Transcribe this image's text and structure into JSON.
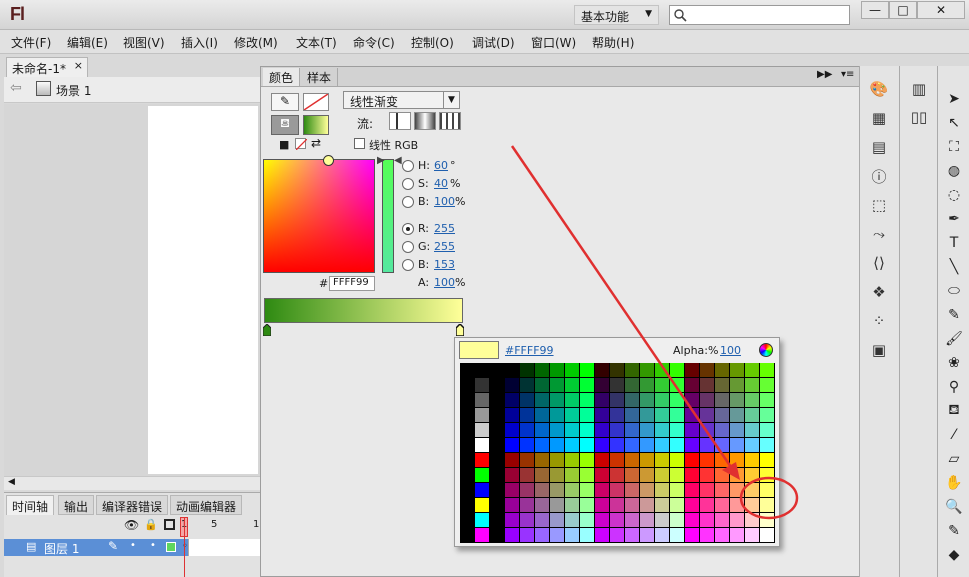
{
  "app": {
    "logo": "Fl"
  },
  "titlebar": {
    "workspace": "基本功能",
    "search_value": ""
  },
  "window_controls": {
    "minimize": "—",
    "maximize": "□",
    "close": "✕"
  },
  "menubar": [
    "文件(F)",
    "编辑(E)",
    "视图(V)",
    "插入(I)",
    "修改(M)",
    "文本(T)",
    "命令(C)",
    "控制(O)",
    "调试(D)",
    "窗口(W)",
    "帮助(H)"
  ],
  "document": {
    "tab": "未命名-1*",
    "close": "×",
    "scene": "场景 1"
  },
  "timeline": {
    "tabs": [
      "时间轴",
      "输出",
      "编译器错误",
      "动画编辑器"
    ],
    "frame_numbers": [
      "1",
      "5",
      "1"
    ],
    "layer": "图层 1"
  },
  "color_panel": {
    "tabs": [
      "颜色",
      "样本"
    ],
    "fill_type": "线性渐变",
    "flow_label": "流:",
    "linear_rgb": "线性 RGB",
    "hex_prefix": "#",
    "hex": "FFFF99",
    "hsb": {
      "h_label": "H:",
      "h": "60",
      "h_unit": "°",
      "s_label": "S:",
      "s": "40",
      "s_unit": "%",
      "b_label": "B:",
      "b": "100",
      "b_unit": "%"
    },
    "rgb": {
      "r_label": "R:",
      "r": "255",
      "g_label": "G:",
      "g": "255",
      "b_label": "B:",
      "b": "153"
    },
    "alpha": {
      "label": "A:",
      "value": "100",
      "unit": "%"
    },
    "gradient": {
      "start": "#2e8a12",
      "end": "#ffff99"
    }
  },
  "swatch_popup": {
    "hex": "#FFFF99",
    "alpha_label": "Alpha:%",
    "alpha": "100",
    "current_color": "#ffff99"
  },
  "colors": {
    "accent_red": "#e03030",
    "selection_blue": "#5b8fd6"
  },
  "dock_icons": [
    "paint-bucket-swatch-icon",
    "align-grid-icon",
    "align-icon",
    "info-icon",
    "transform-icon",
    "motion-icon",
    "code-icon",
    "component-icon",
    "nodes-icon",
    "movieclip-icon"
  ],
  "dock2_icons": [
    "library-icon",
    "books-icon"
  ],
  "tools": [
    "arrow-tool-icon",
    "subselect-tool-icon",
    "free-transform-icon",
    "3d-rotation-icon",
    "lasso-icon",
    "pen-icon",
    "text-tool-icon",
    "line-tool-icon",
    "oval-tool-icon",
    "pencil-icon",
    "brush-icon",
    "deco-icon",
    "bone-icon",
    "paint-bucket-icon",
    "eyedropper-icon",
    "eraser-icon",
    "hand-icon",
    "zoom-icon",
    "stroke-color-icon",
    "fill-color-icon"
  ]
}
